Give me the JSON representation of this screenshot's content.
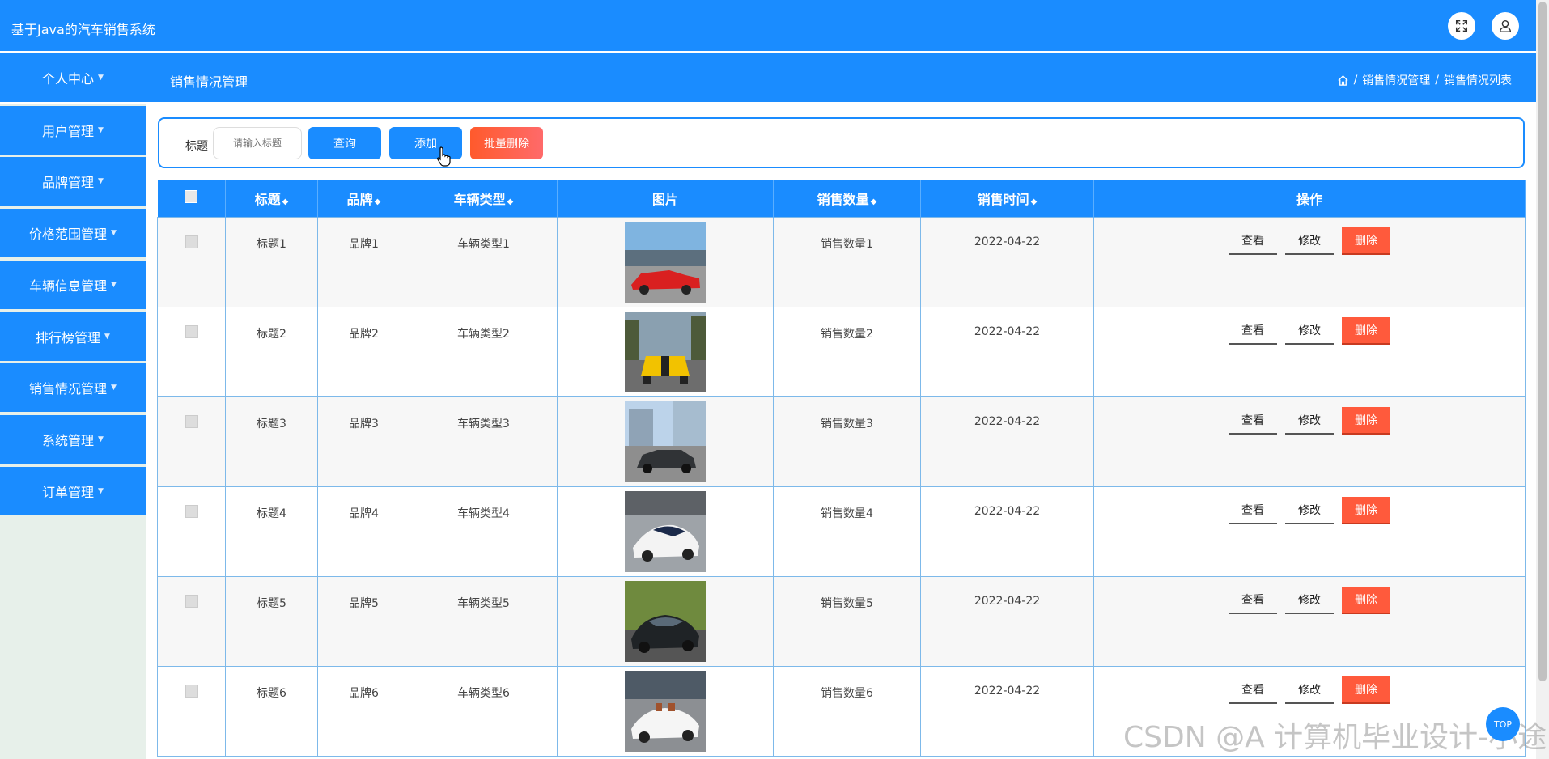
{
  "app": {
    "title": "基于Java的汽车销售系统"
  },
  "header": {
    "page_title": "销售情况管理",
    "breadcrumb": {
      "level1": "销售情况管理",
      "level2": "销售情况列表",
      "sep": "/"
    }
  },
  "sidebar": {
    "items": [
      {
        "label": "个人中心"
      },
      {
        "label": "用户管理"
      },
      {
        "label": "品牌管理"
      },
      {
        "label": "价格范围管理"
      },
      {
        "label": "车辆信息管理"
      },
      {
        "label": "排行榜管理"
      },
      {
        "label": "销售情况管理"
      },
      {
        "label": "系统管理"
      },
      {
        "label": "订单管理"
      }
    ]
  },
  "search": {
    "label": "标题",
    "placeholder": "请输入标题",
    "query_button": "查询",
    "add_button": "添加",
    "batch_delete_button": "批量删除"
  },
  "table": {
    "columns": [
      "标题",
      "品牌",
      "车辆类型",
      "图片",
      "销售数量",
      "销售时间",
      "操作"
    ],
    "rows": [
      {
        "title": "标题1",
        "brand": "品牌1",
        "vtype": "车辆类型1",
        "qty": "销售数量1",
        "time": "2022-04-22",
        "image": "red-convertible"
      },
      {
        "title": "标题2",
        "brand": "品牌2",
        "vtype": "车辆类型2",
        "qty": "销售数量2",
        "time": "2022-04-22",
        "image": "yellow-muscle-car"
      },
      {
        "title": "标题3",
        "brand": "品牌3",
        "vtype": "车辆类型3",
        "qty": "销售数量3",
        "time": "2022-04-22",
        "image": "dark-sedan"
      },
      {
        "title": "标题4",
        "brand": "品牌4",
        "vtype": "车辆类型4",
        "qty": "销售数量4",
        "time": "2022-04-22",
        "image": "white-concept-car"
      },
      {
        "title": "标题5",
        "brand": "品牌5",
        "vtype": "车辆类型5",
        "qty": "销售数量5",
        "time": "2022-04-22",
        "image": "black-sports-car"
      },
      {
        "title": "标题6",
        "brand": "品牌6",
        "vtype": "车辆类型6",
        "qty": "销售数量6",
        "time": "2022-04-22",
        "image": "white-roadster"
      }
    ],
    "actions": {
      "view": "查看",
      "edit": "修改",
      "delete": "删除"
    }
  },
  "fab": {
    "label": "TOP"
  },
  "watermark": "CSDN @A 计算机毕业设计-小途",
  "colors": {
    "primary": "#1a8cff",
    "danger": "#ff5a3c",
    "sidebar_bg": "#e7f0ea"
  }
}
